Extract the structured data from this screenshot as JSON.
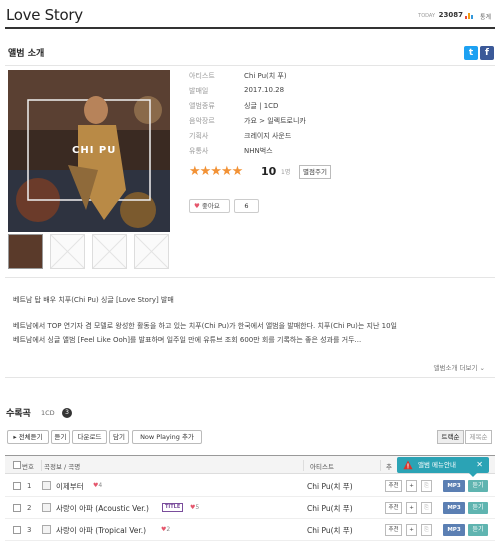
{
  "header": {
    "title": "Love Story",
    "today_label": "TODAY",
    "today_count": "23087",
    "more_label": "통계"
  },
  "album_intro": {
    "section_title": "앨범 소개",
    "share_twitter": "t",
    "share_facebook": "f",
    "cover_text": "CHI PU",
    "info": [
      {
        "label": "아티스트",
        "value": "Chi Pu(치 푸)"
      },
      {
        "label": "발매일",
        "value": "2017.10.28"
      },
      {
        "label": "앨범종류",
        "value": "싱글 | 1CD"
      },
      {
        "label": "음악장르",
        "value": "가요 > 일렉트로니카"
      },
      {
        "label": "기획사",
        "value": "크레이지 사운드"
      },
      {
        "label": "유통사",
        "value": "NHN벅스"
      }
    ],
    "rating": {
      "stars": "★★★★★",
      "score": "10",
      "raters": "1명",
      "rate_button": "별점주기"
    },
    "like_label": "좋아요",
    "like_count": "6"
  },
  "description": {
    "line1": "베트남 탑 배우 치푸(Chi Pu) 싱글 [Love Story] 발매",
    "line2": "베트남에서 TOP 연기자 겸 모델로 왕성한 활동을 하고 있는 치푸(Chi Pu)가 한국에서 앨범을 발매한다. 치푸(Chi Pu)는 지난 10일",
    "line3": "베트남에서 싱글 앨범 [Feel Like Ooh]를 발표하며 일주일 만에 유튜브 조회 600만 회를 기록하는 좋은 성과를 거두...",
    "more_label": "앨범소개 더보기 ⌄"
  },
  "tracks": {
    "section_title": "수록곡",
    "sub_label": "1CD",
    "cd_number": "3",
    "toolbar": [
      "▸ 전체듣기",
      "듣기",
      "다운로드",
      "담기",
      "Now Playing 추가"
    ],
    "sort": {
      "track": "트랙순",
      "title": "제목순"
    },
    "headers": {
      "no": "번호",
      "title": "곡정보 / 곡명",
      "artist": "아티스트",
      "extra": "추"
    },
    "tooltip": "앨범 메뉴안내",
    "tooltip_close": "✕",
    "rows": [
      {
        "no": "1",
        "title": "이제부터",
        "badge": "",
        "likes": "4",
        "artist": "Chi Pu(치 푸)"
      },
      {
        "no": "2",
        "title": "사랑이 아파 (Acoustic Ver.)",
        "badge": "TITLE",
        "likes": "5",
        "artist": "Chi Pu(치 푸)"
      },
      {
        "no": "3",
        "title": "사랑이 아파 (Tropical Ver.)",
        "badge": "",
        "likes": "2",
        "artist": "Chi Pu(치 푸)"
      }
    ],
    "row_buttons": {
      "recommend": "추천",
      "add": "+",
      "share": "⎘",
      "mp3": "MP3",
      "listen": "듣기"
    }
  },
  "colors": {
    "accent_star": "#f29236",
    "mp3_blue": "#5b7fb3",
    "listen_teal": "#5fb4b0",
    "tooltip": "#2ba3b5",
    "twitter": "#1da1f2",
    "facebook": "#3b5998"
  }
}
